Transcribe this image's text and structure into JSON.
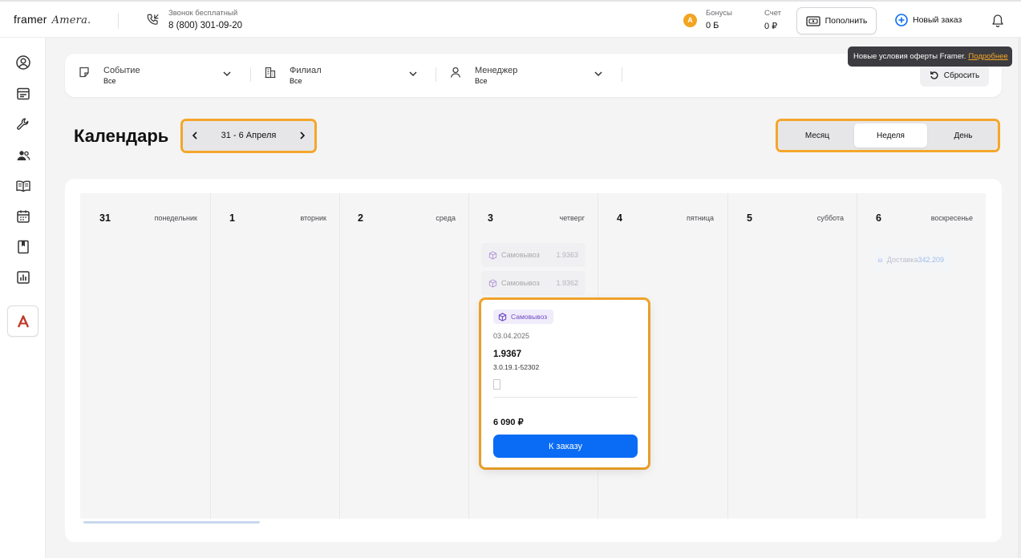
{
  "header": {
    "brand": "framer",
    "brand_partner": "Amera.",
    "phone_caption": "Звонок бесплатный",
    "phone_number": "8 (800) 301-09-20",
    "bonus_caption": "Бонусы",
    "bonus_value": "0 Б",
    "bonus_coin_letter": "A",
    "account_caption": "Счет",
    "account_value": "0 ₽",
    "topup_label": "Пополнить",
    "new_order_label": "Новый заказ"
  },
  "sidebar": {
    "items": [
      {
        "icon": "profile-icon"
      },
      {
        "icon": "orders-icon"
      },
      {
        "icon": "tools-icon"
      },
      {
        "icon": "users-icon"
      },
      {
        "icon": "catalog-book-icon"
      },
      {
        "icon": "calendar-icon"
      },
      {
        "icon": "bookmark-icon"
      },
      {
        "icon": "reports-chart-icon"
      }
    ],
    "brand_tile_letter": "A"
  },
  "filters": {
    "event": {
      "label": "Событие",
      "value": "Все"
    },
    "branch": {
      "label": "Филиал",
      "value": "Все"
    },
    "manager": {
      "label": "Менеджер",
      "value": "Все"
    },
    "reset_label": "Сбросить"
  },
  "tooltip": {
    "text": "Новые условия оферты Framer.",
    "link": "Подробнее"
  },
  "calendar": {
    "title": "Календарь",
    "range": "31 - 6 Апреля",
    "views": [
      "Месяц",
      "Неделя",
      "День"
    ],
    "active_view": "Неделя",
    "days": [
      {
        "num": "31",
        "name": "понедельник"
      },
      {
        "num": "1",
        "name": "вторник"
      },
      {
        "num": "2",
        "name": "среда"
      },
      {
        "num": "3",
        "name": "четверг"
      },
      {
        "num": "4",
        "name": "пятница"
      },
      {
        "num": "5",
        "name": "суббота"
      },
      {
        "num": "6",
        "name": "воскресенье"
      }
    ],
    "events": [
      {
        "day": "3",
        "type": "Самовывоз",
        "number": "1.9363"
      },
      {
        "day": "3",
        "type": "Самовывоз",
        "number": "1.9362"
      },
      {
        "day": "6",
        "type": "Доставка",
        "number": "342.209"
      }
    ]
  },
  "popup": {
    "type": "Самовывоз",
    "date": "03.04.2025",
    "number": "1.9367",
    "code": "3.0.19.1-52302",
    "price": "6 090 ₽",
    "button_label": "К заказу"
  },
  "colors": {
    "accent_blue": "#0a6cf5",
    "highlight_orange": "#f4a62a",
    "brand_red": "#c0392b",
    "coin_orange": "#f2a51f",
    "pickup_purple": "#6e4ac2"
  }
}
